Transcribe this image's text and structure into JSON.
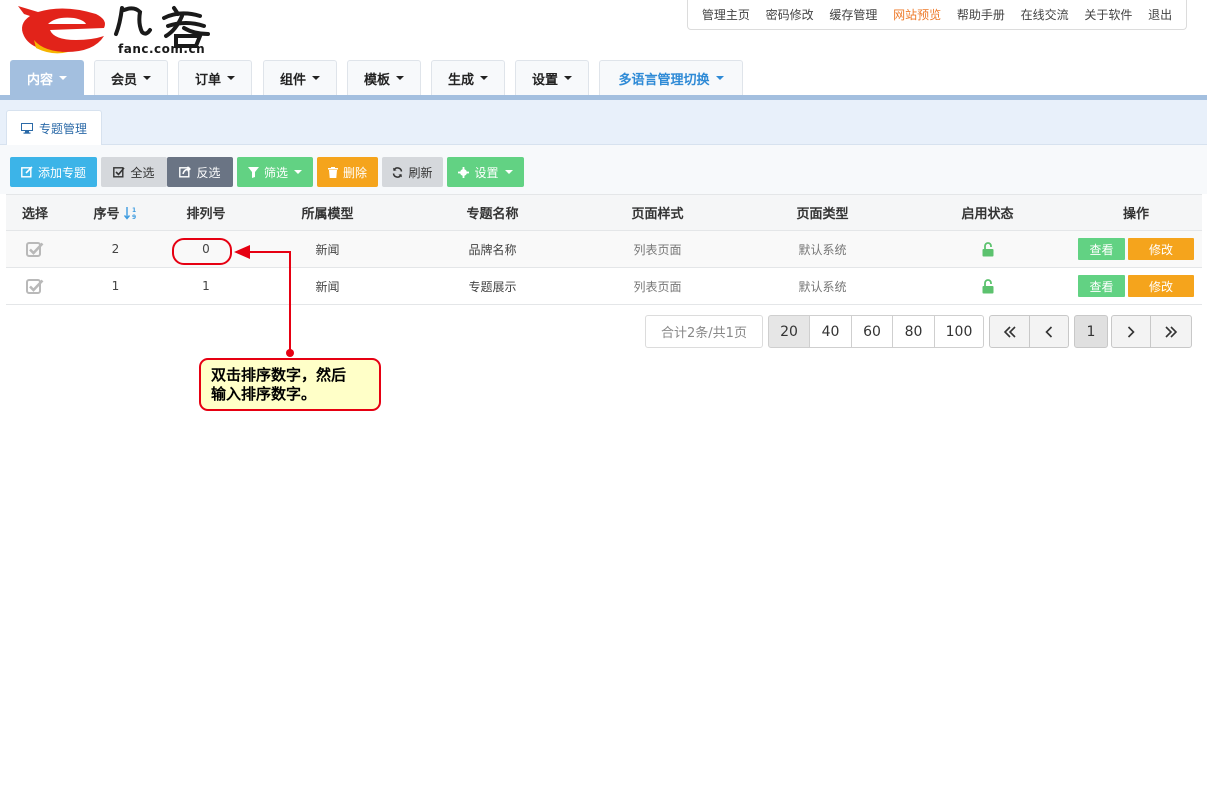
{
  "header": {
    "logo_text": "fanc.com.cn",
    "top_links": [
      "管理主页",
      "密码修改",
      "缓存管理",
      "网站预览",
      "帮助手册",
      "在线交流",
      "关于软件",
      "退出"
    ],
    "highlight_link_color": "#ee7a2a"
  },
  "nav": {
    "tabs": [
      "内容",
      "会员",
      "订单",
      "组件",
      "模板",
      "生成",
      "设置",
      "多语言管理切换"
    ],
    "active_color": "#a3bfdf"
  },
  "subnav": {
    "tab": "专题管理"
  },
  "toolbar": {
    "add": "添加专题",
    "select_all": "全选",
    "invert": "反选",
    "filter": "筛选",
    "delete": "删除",
    "refresh": "刷新",
    "settings": "设置"
  },
  "table": {
    "headers": [
      "选择",
      "序号",
      "排列号",
      "所属模型",
      "专题名称",
      "页面样式",
      "页面类型",
      "启用状态",
      "操作"
    ],
    "rows": [
      {
        "id": "2",
        "sort": "0",
        "model": "新闻",
        "name": "品牌名称",
        "style": "列表页面",
        "type": "默认系统"
      },
      {
        "id": "1",
        "sort": "1",
        "model": "新闻",
        "name": "专题展示",
        "style": "列表页面",
        "type": "默认系统"
      }
    ],
    "view_label": "查看",
    "edit_label": "修改"
  },
  "pagination": {
    "total": "合计2条/共1页",
    "sizes": [
      "20",
      "40",
      "60",
      "80",
      "100"
    ],
    "current_page": "1"
  },
  "annotation": {
    "line1": "双击排序数字，然后",
    "line2": "输入排序数字。",
    "color": "#e60012"
  }
}
